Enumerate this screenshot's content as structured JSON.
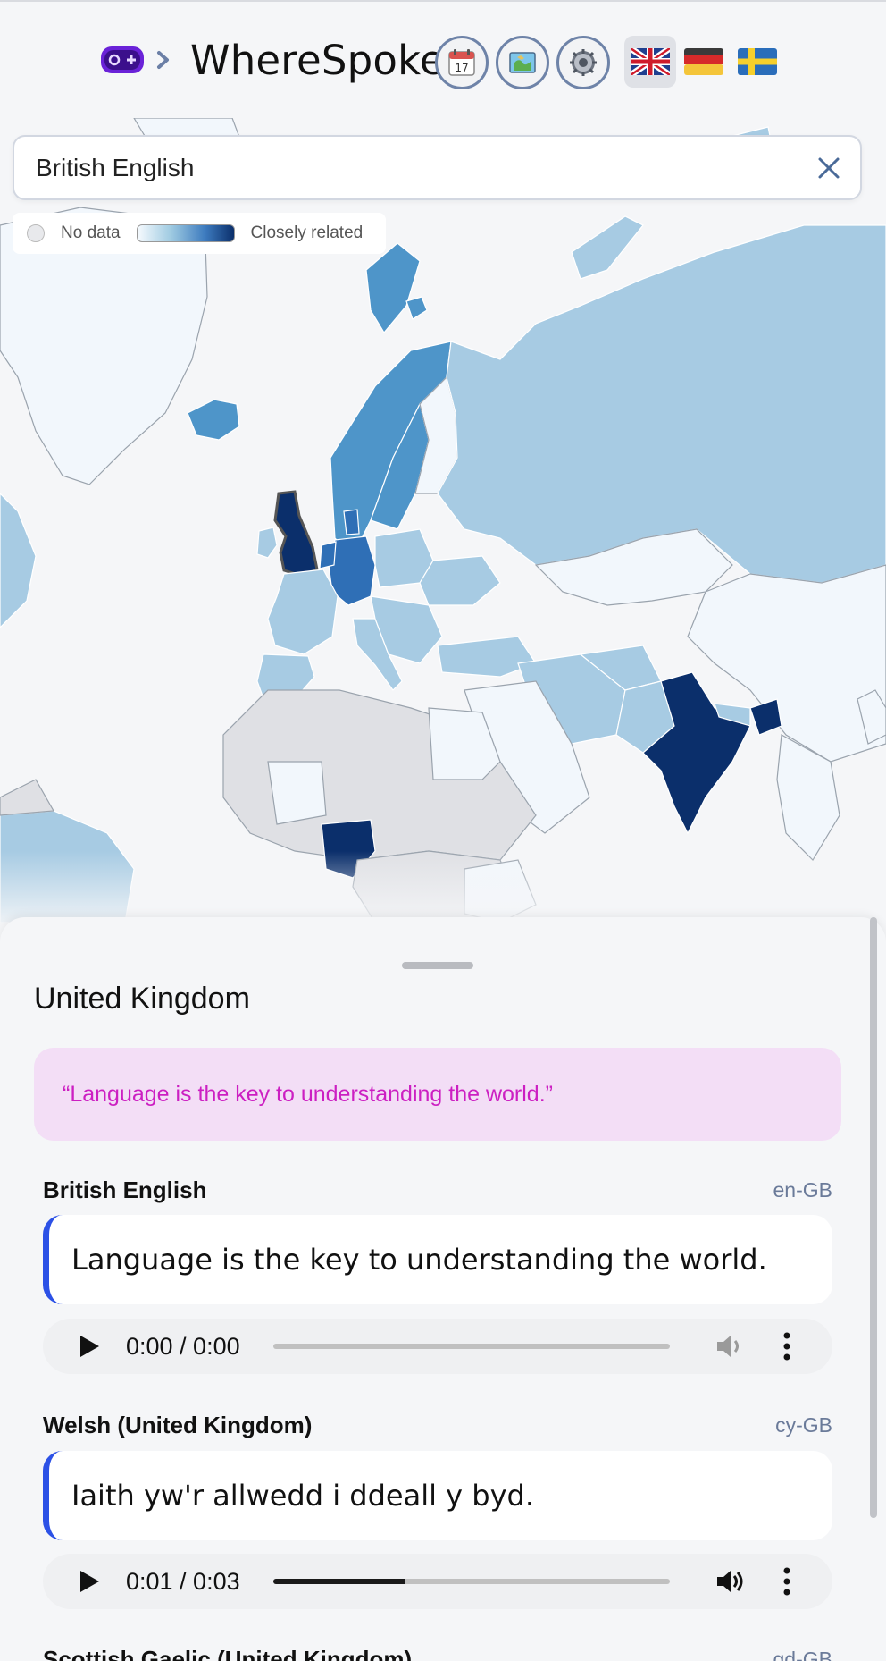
{
  "app": {
    "title": "WhereSpoken"
  },
  "header": {
    "icons": [
      "gamepad-icon",
      "chevron-right-icon",
      "calendar-icon",
      "map-icon",
      "settings-icon"
    ],
    "calendar_day": "17",
    "flags": [
      "uk-flag-icon",
      "germany-flag-icon",
      "sweden-flag-icon"
    ],
    "active_flag": "uk-flag-icon"
  },
  "search": {
    "value": "British English"
  },
  "legend": {
    "no_data": "No data",
    "related": "Closely related"
  },
  "colors": {
    "darkest": "#0b2f6b",
    "dark": "#2f6fb6",
    "mid": "#4e95c9",
    "light": "#a7cbe3",
    "lightest": "#f2f7fc",
    "nodata": "#dfe0e4",
    "accent": "#2c51e6",
    "quote_text": "#cc1fc2",
    "quote_bg": "#f3def6"
  },
  "panel": {
    "country": "United Kingdom",
    "quote": "“Language is the key to understanding the world.”",
    "languages": [
      {
        "name": "British English",
        "code": "en-GB",
        "phrase": "Language is the key to understanding the world.",
        "time": "0:00 / 0:00",
        "progress": 0,
        "muted": true
      },
      {
        "name": "Welsh (United Kingdom)",
        "code": "cy-GB",
        "phrase": "Iaith yw'r allwedd i ddeall y byd.",
        "time": "0:01 / 0:03",
        "progress": 0.33,
        "muted": false
      },
      {
        "name": "Scottish Gaelic (United Kingdom)",
        "code": "gd-GB"
      }
    ]
  }
}
